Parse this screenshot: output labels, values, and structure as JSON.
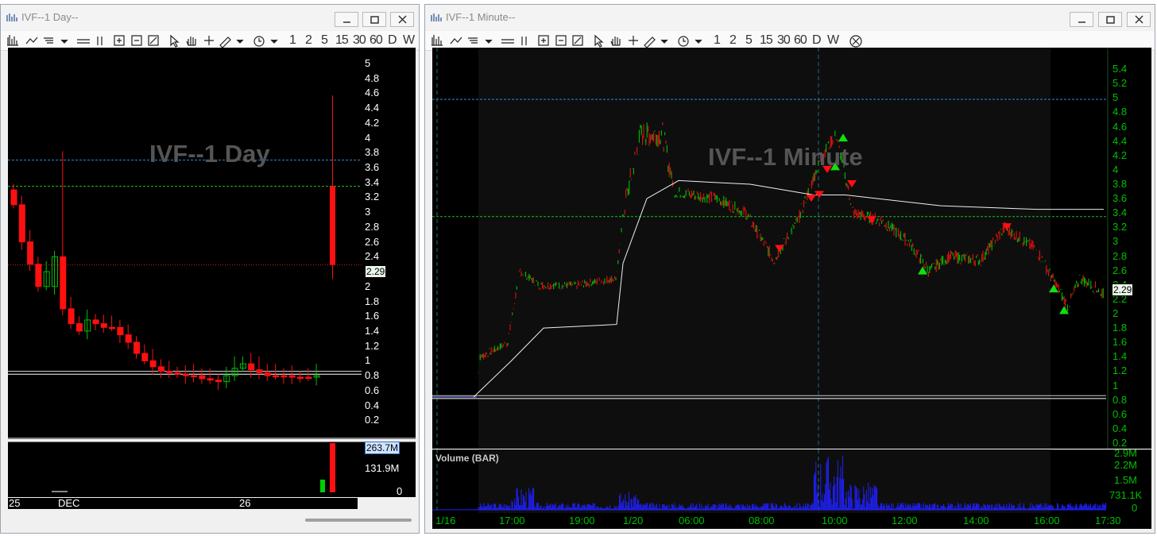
{
  "left_window": {
    "title": "IVF--1 Day--",
    "watermark": "IVF--1 Day",
    "toolbar_periods": [
      "1",
      "2",
      "5",
      "15",
      "30",
      "60",
      "D",
      "W"
    ],
    "price_ticks": [
      "5",
      "4.8",
      "4.6",
      "4.4",
      "4.2",
      "4",
      "3.8",
      "3.6",
      "3.4",
      "3.2",
      "3",
      "2.8",
      "2.6",
      "2.4",
      "2.2",
      "2",
      "1.8",
      "1.6",
      "1.4",
      "1.2",
      "1",
      "0.8",
      "0.6",
      "0.4",
      "0.2"
    ],
    "last_price": "2.29",
    "volume_last": "263.7M",
    "volume_ticks": [
      "131.9M",
      "0"
    ],
    "date_labels": [
      "25",
      "DEC",
      "26"
    ]
  },
  "right_window": {
    "title": "IVF--1 Minute--",
    "watermark": "IVF--1 Minute",
    "toolbar_periods": [
      "1",
      "2",
      "5",
      "15",
      "30",
      "60",
      "D",
      "W"
    ],
    "price_ticks": [
      "5.4",
      "5.2",
      "5",
      "4.8",
      "4.6",
      "4.4",
      "4.2",
      "4",
      "3.8",
      "3.6",
      "3.4",
      "3.2",
      "3",
      "2.8",
      "2.6",
      "2.4",
      "2.2",
      "2",
      "1.8",
      "1.6",
      "1.4",
      "1.2",
      "1",
      "0.8",
      "0.6",
      "0.4",
      "0.2"
    ],
    "last_price": "2.29",
    "volume_label": "Volume (BAR)",
    "volume_ticks": [
      "2.9M",
      "2.2M",
      "1.5M",
      "731.1K",
      "0"
    ],
    "time_labels": [
      "1/16",
      "17:00",
      "19:00",
      "1/20",
      "06:00",
      "08:00",
      "10:00",
      "12:00",
      "14:00",
      "16:00",
      "17:30"
    ]
  },
  "chart_data": [
    {
      "type": "candlestick",
      "title": "IVF--1 Day",
      "ylim": [
        0,
        5
      ],
      "levels": {
        "blue_dashed": 3.7,
        "green_dashed": 3.35,
        "red_dotted": 2.29
      },
      "last_candle": {
        "open": 3.35,
        "close": 2.29,
        "high": 4.57,
        "low": 2.1
      },
      "closes": [
        3.1,
        2.6,
        2.3,
        2.0,
        2.2,
        2.4,
        1.7,
        1.5,
        1.4,
        1.55,
        1.5,
        1.45,
        1.45,
        1.35,
        1.25,
        1.1,
        1.0,
        0.92,
        0.86,
        0.84,
        0.82,
        0.8,
        0.8,
        0.76,
        0.74,
        0.72,
        0.8,
        0.9,
        0.96,
        0.88,
        0.84,
        0.8,
        0.8,
        0.8,
        0.78,
        0.78,
        0.78,
        0.8,
        2.29
      ]
    },
    {
      "type": "line",
      "title": "IVF--1 Minute",
      "ylim": [
        0.2,
        5.5
      ],
      "levels": {
        "blue_dashed": 4.98,
        "green_dashed": 3.35
      },
      "price_path": [
        [
          0,
          0.84
        ],
        [
          52,
          0.84
        ],
        [
          60,
          1.4
        ],
        [
          95,
          1.6
        ],
        [
          110,
          2.6
        ],
        [
          135,
          2.4
        ],
        [
          180,
          2.4
        ],
        [
          232,
          2.5
        ],
        [
          240,
          3.4
        ],
        [
          262,
          4.5
        ],
        [
          290,
          4.5
        ],
        [
          305,
          3.7
        ],
        [
          360,
          3.6
        ],
        [
          395,
          3.4
        ],
        [
          430,
          2.75
        ],
        [
          460,
          3.3
        ],
        [
          490,
          4.2
        ],
        [
          508,
          4.5
        ],
        [
          530,
          3.4
        ],
        [
          565,
          3.3
        ],
        [
          600,
          3.0
        ],
        [
          625,
          2.6
        ],
        [
          650,
          2.8
        ],
        [
          690,
          2.75
        ],
        [
          720,
          3.2
        ],
        [
          760,
          2.9
        ],
        [
          790,
          2.3
        ],
        [
          800,
          2.1
        ],
        [
          815,
          2.5
        ],
        [
          845,
          2.29
        ]
      ],
      "vwap_path": [
        [
          52,
          0.84
        ],
        [
          100,
          1.35
        ],
        [
          140,
          1.8
        ],
        [
          232,
          1.85
        ],
        [
          240,
          2.7
        ],
        [
          270,
          3.6
        ],
        [
          310,
          3.85
        ],
        [
          400,
          3.8
        ],
        [
          480,
          3.65
        ],
        [
          520,
          3.65
        ],
        [
          640,
          3.5
        ],
        [
          760,
          3.45
        ],
        [
          845,
          3.45
        ]
      ],
      "volume_max": "2.9M"
    }
  ]
}
